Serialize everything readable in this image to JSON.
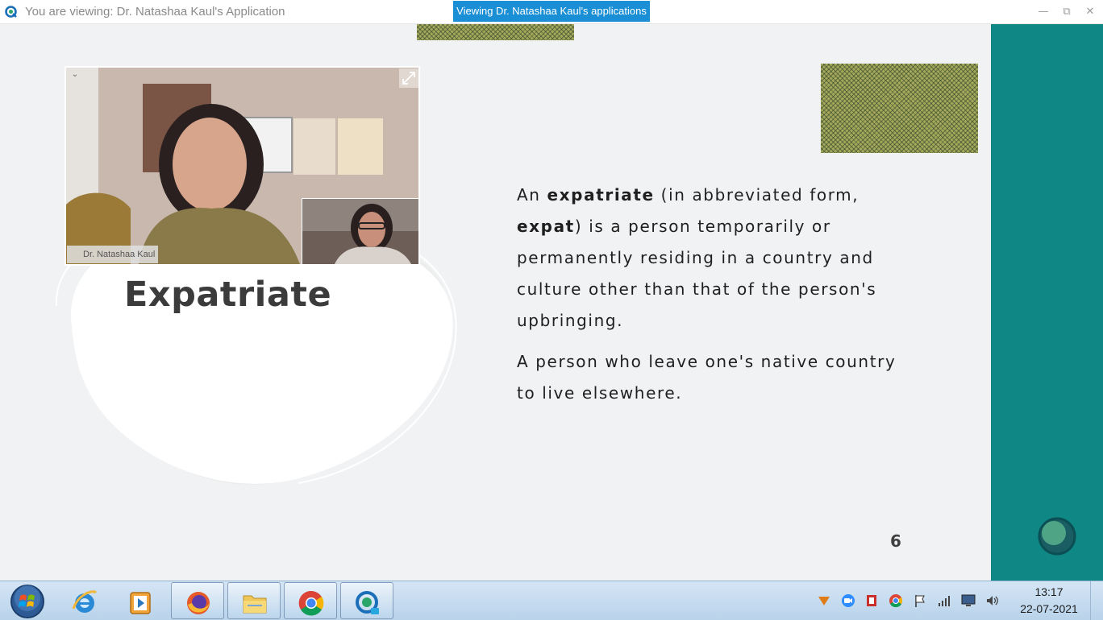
{
  "window": {
    "title": "You are viewing: Dr. Natashaa Kaul's Application",
    "viewing_banner": "Viewing Dr. Natashaa Kaul's applications"
  },
  "slide": {
    "title": "Expatriate",
    "paragraph1": {
      "t1": "An ",
      "b1": "expatriate",
      "t2": " (in abbreviated form, ",
      "b2": "expat",
      "t3": ") is a person temporarily or permanently residing in a country and culture other than that of the person's upbringing."
    },
    "paragraph2": "A person who leave one's native country to live elsewhere.",
    "page_number": "6"
  },
  "video": {
    "presenter_name": "Dr. Natashaa Kaul"
  },
  "taskbar": {
    "time": "13:17",
    "date": "22-07-2021",
    "pinned": [
      "internet-explorer",
      "media-player",
      "firefox",
      "file-explorer",
      "chrome",
      "meeting-app"
    ]
  },
  "colors": {
    "accent_teal": "#0f8785",
    "banner_blue": "#1a8fd6",
    "pattern_olive": "#a4a85a"
  }
}
